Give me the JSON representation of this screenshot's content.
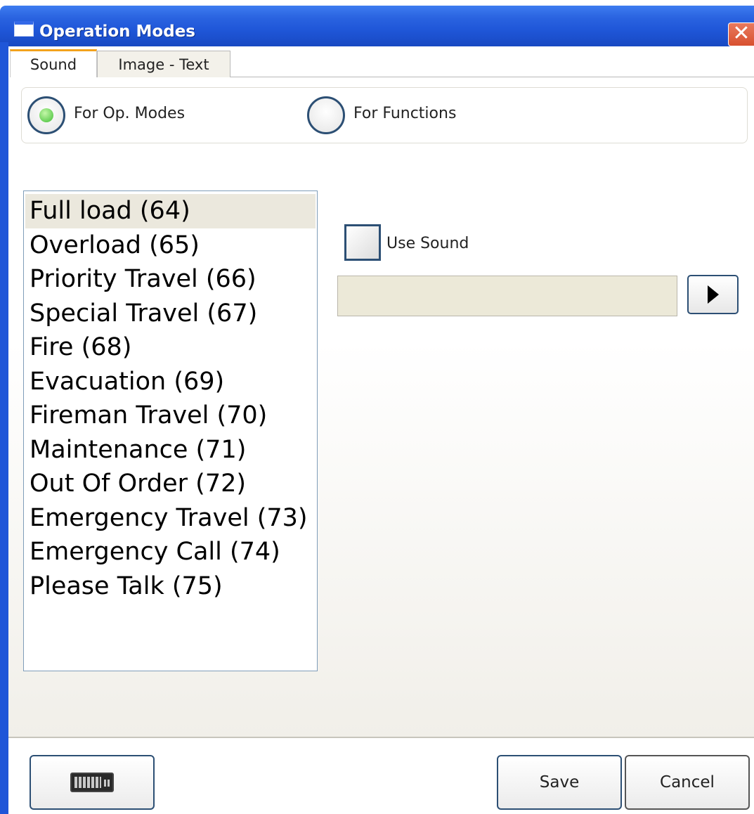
{
  "window": {
    "title": "Operation Modes",
    "close_symbol": "✕"
  },
  "tabs": [
    {
      "label": "Sound",
      "active": true
    },
    {
      "label": "Image - Text",
      "active": false
    }
  ],
  "radios": [
    {
      "label": "For Op. Modes",
      "checked": true
    },
    {
      "label": "For Functions",
      "checked": false
    }
  ],
  "list": {
    "selected_index": 0,
    "items": [
      "Full load (64)",
      "Overload (65)",
      "Priority Travel (66)",
      "Special Travel (67)",
      "Fire (68)",
      "Evacuation (69)",
      "Fireman Travel (70)",
      "Maintenance (71)",
      "Out Of Order (72)",
      "Emergency Travel (73)",
      "Emergency Call (74)",
      "Please Talk (75)"
    ]
  },
  "sound": {
    "use_sound_label": "Use Sound",
    "use_sound_checked": false,
    "file_value": "",
    "play_icon": "play-icon"
  },
  "buttons": {
    "keyboard_icon": "keyboard-icon",
    "save_label": "Save",
    "cancel_label": "Cancel"
  },
  "colors": {
    "titlebar": "#1f56d8",
    "selection": "#ebe8dd",
    "radio_checked": "#3fbe34",
    "tab_accent": "#f3a21c"
  }
}
